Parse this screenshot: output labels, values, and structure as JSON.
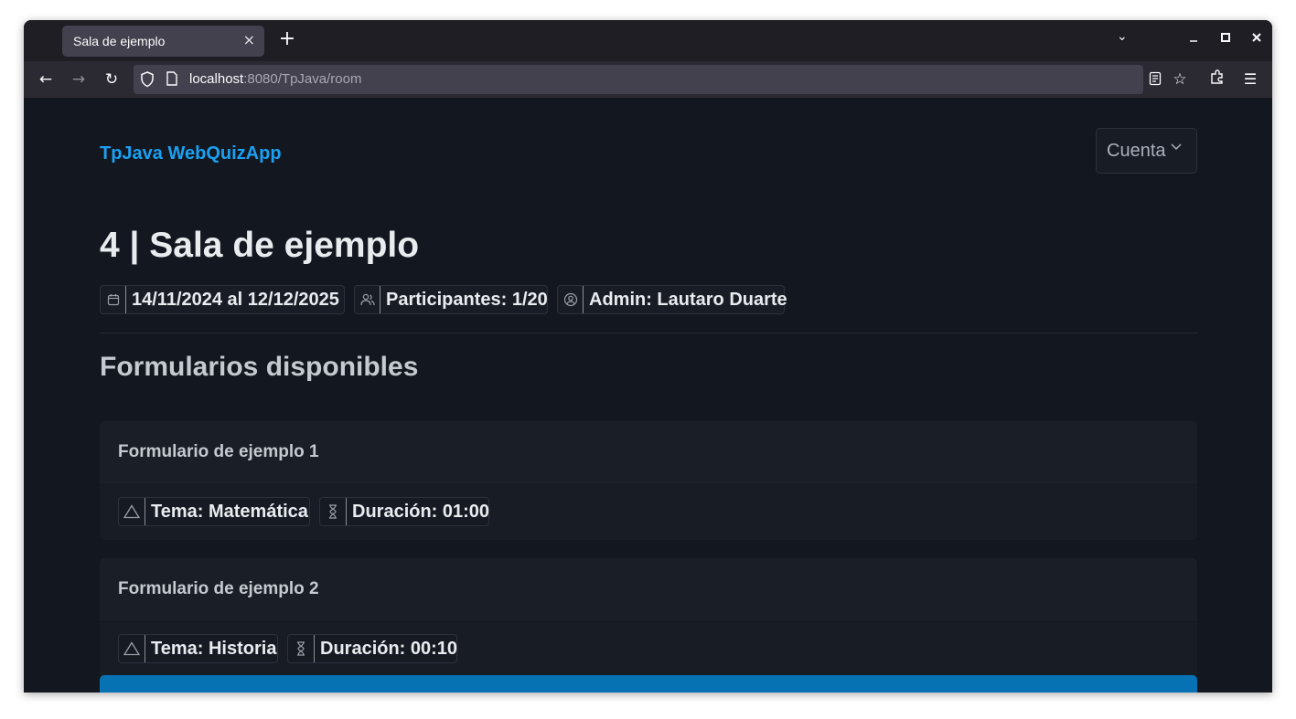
{
  "browser": {
    "tab_title": "Sala de ejemplo",
    "tab_close": "×",
    "new_tab": "+",
    "url_host": "localhost",
    "url_path": ":8080/TpJava/room",
    "icons": [
      "back-icon",
      "forward-icon",
      "reload-icon",
      "shield-icon",
      "page-icon",
      "reader-view-icon",
      "bookmark-star-icon",
      "extensions-icon",
      "menu-icon",
      "tab-list-icon",
      "minimize-icon",
      "maximize-icon",
      "close-icon"
    ]
  },
  "header": {
    "brand": "TpJava WebQuizApp",
    "account_label": "Cuenta"
  },
  "room": {
    "title": "4 | Sala de ejemplo",
    "dates": "14/11/2024 al 12/12/2025",
    "participants": "Participantes: 1/20",
    "admin": "Admin: Lautaro Duarte"
  },
  "forms_section": {
    "title": "Formularios disponibles",
    "forms": [
      {
        "title": "Formulario de ejemplo 1",
        "topic": "Tema: Matemática",
        "duration": "Duración: 01:00"
      },
      {
        "title": "Formulario de ejemplo 2",
        "topic": "Tema: Historia",
        "duration": "Duración: 00:10"
      }
    ]
  },
  "colors": {
    "brand": "#1ba0f2",
    "page_bg": "#13171f",
    "card_bg": "#181c25",
    "primary_button": "#0672b4"
  }
}
